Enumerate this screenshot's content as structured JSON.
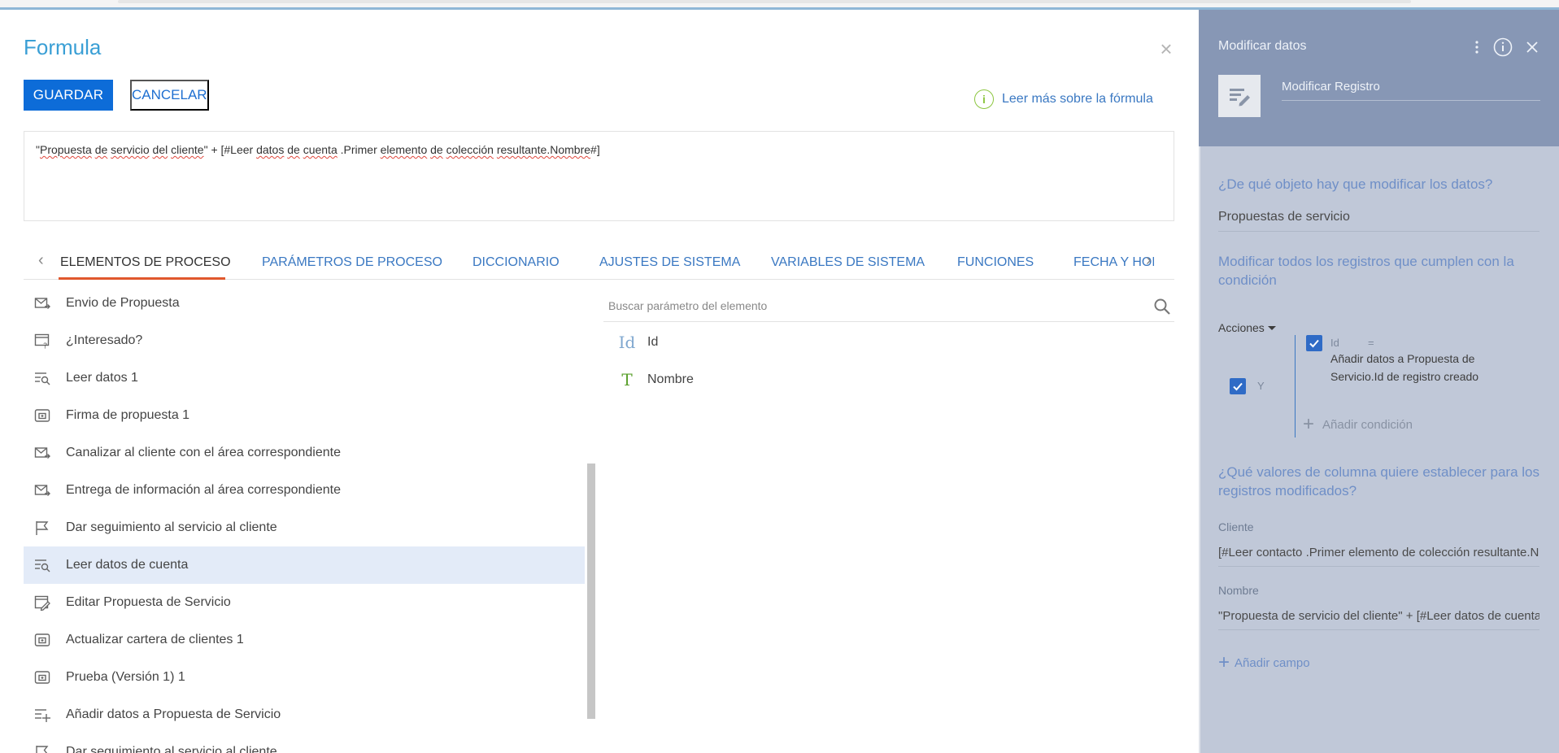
{
  "modal": {
    "title": "Formula",
    "save_label": "GUARDAR",
    "cancel_label": "CANCELAR",
    "read_more_label": "Leer más sobre la fórmula",
    "formula": {
      "p1": "\"",
      "w1": "Propuesta",
      "s1": " ",
      "w2": "de",
      "s2": " ",
      "w3": "servicio",
      "s3": " ",
      "w4": "del",
      "s4": " ",
      "w5": "cliente",
      "p2": "\" + [#Leer ",
      "w6": "datos",
      "s5": " ",
      "w7": "de",
      "s6": " ",
      "w8": "cuenta",
      "p3": " .Primer ",
      "w9": "elemento",
      "s7": " ",
      "w10": "de",
      "s8": " ",
      "w11": "colección",
      "s9": " ",
      "w12": "resultante.Nombre",
      "p4": "#]"
    }
  },
  "tabs": [
    {
      "label": "ELEMENTOS DE PROCESO",
      "active": true
    },
    {
      "label": "PARÁMETROS DE PROCESO"
    },
    {
      "label": "DICCIONARIO"
    },
    {
      "label": "AJUSTES DE SISTEMA"
    },
    {
      "label": "VARIABLES DE SISTEMA"
    },
    {
      "label": "FUNCIONES"
    },
    {
      "label": "FECHA Y HORA"
    }
  ],
  "elements": [
    {
      "label": "Envio de Propuesta",
      "icon": "email-send-icon"
    },
    {
      "label": "¿Interesado?",
      "icon": "question-page-icon"
    },
    {
      "label": "Leer datos 1",
      "icon": "read-data-icon"
    },
    {
      "label": "Firma de propuesta 1",
      "icon": "subprocess-icon"
    },
    {
      "label": "Canalizar al cliente con el área correspondiente",
      "icon": "email-send-icon"
    },
    {
      "label": "Entrega de información al área correspondiente",
      "icon": "email-send-icon"
    },
    {
      "label": "Dar seguimiento al servicio al cliente",
      "icon": "flag-icon"
    },
    {
      "label": "Leer datos de cuenta",
      "icon": "read-data-icon",
      "selected": true
    },
    {
      "label": "Editar Propuesta de Servicio",
      "icon": "edit-page-icon"
    },
    {
      "label": "Actualizar cartera de clientes 1",
      "icon": "subprocess-icon"
    },
    {
      "label": "Prueba (Versión 1) 1",
      "icon": "subprocess-icon"
    },
    {
      "label": "Añadir datos a Propuesta de Servicio",
      "icon": "add-data-icon"
    },
    {
      "label": "Dar seguimiento al servicio al cliente",
      "icon": "flag-icon"
    }
  ],
  "params": {
    "search_placeholder": "Buscar parámetro del elemento",
    "items": [
      {
        "type": "Id",
        "label": "Id",
        "color": "#7fa7cf"
      },
      {
        "type": "T",
        "label": "Nombre",
        "color": "#5aa02c"
      }
    ]
  },
  "panel": {
    "title": "Modificar datos",
    "record_name": "Modificar Registro",
    "q_object": "¿De qué objeto hay que modificar los datos?",
    "object_value": "Propuestas de servicio",
    "q_condition": "Modificar todos los registros que cumplen con la condición",
    "actions_label": "Acciones",
    "and_label": "Y",
    "cond_field": "Id",
    "cond_op": "=",
    "cond_value": "Añadir datos a Propuesta de Servicio.Id de registro creado",
    "add_condition": "Añadir condición",
    "q_values": "¿Qué valores de columna quiere establecer para los registros modificados?",
    "fields": [
      {
        "label": "Cliente",
        "value": "[#Leer contacto .Primer elemento de colección resultante.Nombre#]"
      },
      {
        "label": "Nombre",
        "value": "\"Propuesta de servicio del cliente\" + [#Leer datos de cuenta .Primer elemento de colección resultante.Nombre#]"
      }
    ],
    "add_field": "Añadir campo"
  },
  "colors": {
    "accent": "#0d6cd8",
    "link": "#3a78c2",
    "tab_underline": "#e0582d",
    "panel_header": "#8797b5",
    "panel_body": "#c0c8d8",
    "selected_row": "#e3ebf8"
  }
}
